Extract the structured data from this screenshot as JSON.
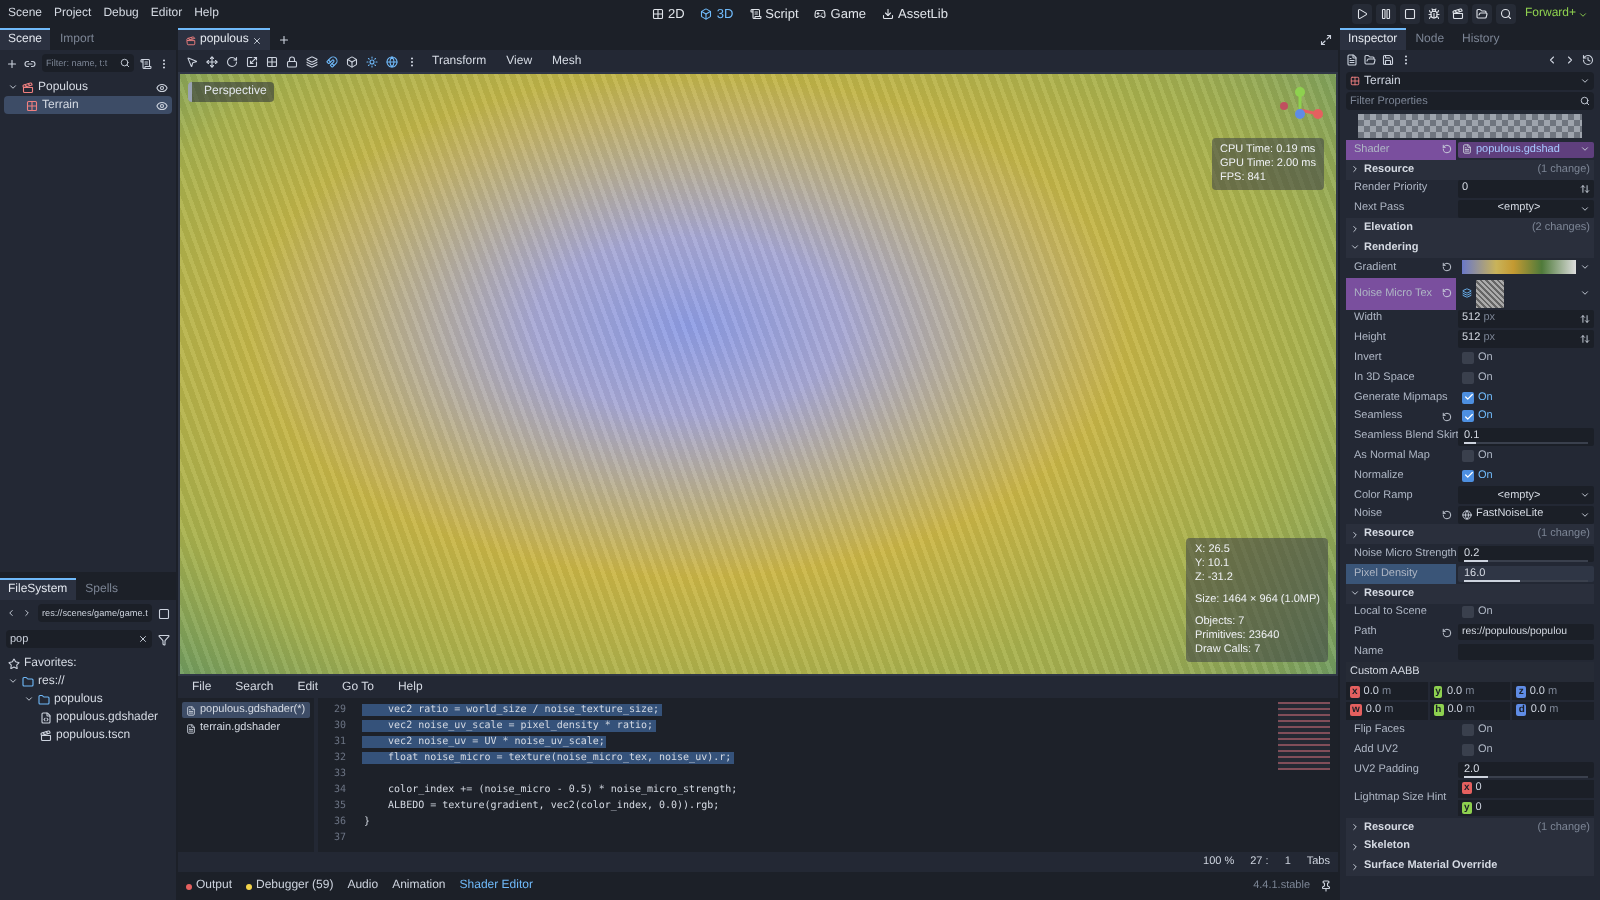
{
  "menu": [
    "Scene",
    "Project",
    "Debug",
    "Editor",
    "Help"
  ],
  "workspaces": [
    {
      "label": "2D",
      "selected": false
    },
    {
      "label": "3D",
      "selected": true
    },
    {
      "label": "Script",
      "selected": false
    },
    {
      "label": "Game",
      "selected": false
    },
    {
      "label": "AssetLib",
      "selected": false
    }
  ],
  "run_bar": {
    "renderer": "Forward+"
  },
  "scene_dock": {
    "tabs": [
      {
        "label": "Scene",
        "selected": true
      },
      {
        "label": "Import",
        "selected": false
      }
    ],
    "filter": {
      "placeholder": "Filter: name, t:t"
    },
    "tree": [
      {
        "name": "Populous",
        "selected": false,
        "children": [
          {
            "name": "Terrain",
            "selected": true
          }
        ]
      }
    ]
  },
  "filesystem": {
    "tabs": [
      {
        "label": "FileSystem",
        "selected": true
      },
      {
        "label": "Spells",
        "selected": false
      }
    ],
    "path": "res://scenes/game/game.t",
    "search": {
      "value": "pop"
    },
    "tree": [
      {
        "name": "Favorites:",
        "kind": "favorites"
      },
      {
        "name": "res://",
        "kind": "folder",
        "children": [
          {
            "name": "populous",
            "kind": "folder",
            "children": [
              {
                "name": "populous.gdshader",
                "kind": "shader"
              },
              {
                "name": "populous.tscn",
                "kind": "scene"
              }
            ]
          }
        ]
      }
    ]
  },
  "viewport": {
    "tabs": [
      {
        "label": "populous",
        "selected": true
      }
    ],
    "menus": [
      "Transform",
      "View",
      "Mesh"
    ],
    "view_label": "Perspective",
    "stats": [
      "CPU Time: 0.19 ms",
      "GPU Time: 2.00 ms",
      "FPS: 841"
    ],
    "info": [
      [
        "X: 26.5",
        "Y: 10.1",
        "Z: -31.2"
      ],
      [
        "Size: 1464 × 964 (1.0MP)"
      ],
      [
        "Objects: 7",
        "Primitives: 23640",
        "Draw Calls: 7"
      ]
    ]
  },
  "script_editor": {
    "menus": [
      "File",
      "Search",
      "Edit",
      "Go To",
      "Help"
    ],
    "files": [
      {
        "name": "populous.gdshader(*)",
        "selected": true
      },
      {
        "name": "terrain.gdshader",
        "selected": false
      }
    ],
    "lines": [
      {
        "number": "29",
        "code": "    vec2 ratio = world_size / noise_texture_size;",
        "selected": true
      },
      {
        "number": "30",
        "code": "    vec2 noise_uv_scale = pixel_density * ratio;",
        "selected": true
      },
      {
        "number": "31",
        "code": "    vec2 noise_uv = UV * noise_uv_scale;",
        "selected": true
      },
      {
        "number": "32",
        "code": "    float noise_micro = texture(noise_micro_tex, noise_uv).r;",
        "selected": true
      },
      {
        "number": "33",
        "selected": false
      },
      {
        "number": "34",
        "code": "    color_index += (noise_micro - 0.5) * noise_micro_strength;",
        "selected": false
      },
      {
        "number": "35",
        "code": "    ALBEDO = texture(gradient, vec2(color_index, 0.0)).rgb;",
        "selected": false
      },
      {
        "number": "36",
        "code": "}",
        "selected": false
      },
      {
        "number": "37",
        "selected": false
      }
    ],
    "status": {
      "zoom": "100 %",
      "line": "27 :",
      "column": "1",
      "indent": "Tabs"
    }
  },
  "bottom_panel": {
    "tabs": [
      {
        "label": "Output",
        "selected": false,
        "color": "#e5605f"
      },
      {
        "label": "Debugger (59)",
        "selected": false,
        "color": "#f3d34a"
      },
      {
        "label": "Audio",
        "selected": false
      },
      {
        "label": "Animation",
        "selected": false
      },
      {
        "label": "Shader Editor",
        "selected": true
      }
    ],
    "version": "4.4.1.stable"
  },
  "inspector": {
    "tabs": [
      {
        "label": "Inspector",
        "selected": true
      },
      {
        "label": "Node",
        "selected": false
      },
      {
        "label": "History",
        "selected": false
      }
    ],
    "object": "Terrain",
    "filter": {
      "placeholder": "Filter Properties"
    },
    "properties": [
      {
        "kind": "preview"
      },
      {
        "kind": "resource",
        "label": "Shader",
        "value": "populous.gdshad",
        "expanded": true,
        "modified": true
      },
      {
        "kind": "section",
        "label": "Resource",
        "note": "(1 change)",
        "expanded": false
      },
      {
        "kind": "spin",
        "label": "Render Priority",
        "value": "0",
        "modified": false
      },
      {
        "kind": "dropdown",
        "label": "Next Pass",
        "value": "<empty>",
        "modified": false
      },
      {
        "kind": "section",
        "label": "Elevation",
        "note": "(2 changes)",
        "expanded": false
      },
      {
        "kind": "section",
        "label": "Rendering",
        "expanded": true
      },
      {
        "kind": "gradient",
        "label": "Gradient",
        "modified": true
      },
      {
        "kind": "texture",
        "label": "Noise Micro Tex",
        "expanded": true,
        "modified": true
      },
      {
        "kind": "spin",
        "label": "Width",
        "value": "512",
        "unit": "px",
        "modified": false
      },
      {
        "kind": "spin",
        "label": "Height",
        "value": "512",
        "unit": "px",
        "modified": false
      },
      {
        "kind": "check",
        "label": "Invert",
        "text": "On",
        "checked": false,
        "modified": false
      },
      {
        "kind": "check",
        "label": "In 3D Space",
        "text": "On",
        "checked": false,
        "modified": false
      },
      {
        "kind": "check",
        "label": "Generate Mipmaps",
        "text": "On",
        "checked": true,
        "modified": false
      },
      {
        "kind": "check",
        "label": "Seamless",
        "text": "On",
        "checked": true,
        "modified": true
      },
      {
        "kind": "slider",
        "label": "Seamless Blend Skirt",
        "value": "0.1",
        "level": 0.1,
        "focused": false,
        "modified": false
      },
      {
        "kind": "check",
        "label": "As Normal Map",
        "text": "On",
        "checked": false,
        "modified": false
      },
      {
        "kind": "check",
        "label": "Normalize",
        "text": "On",
        "checked": true,
        "modified": false
      },
      {
        "kind": "dropdown",
        "label": "Color Ramp",
        "value": "<empty>",
        "modified": false
      },
      {
        "kind": "resource",
        "label": "Noise",
        "value": "FastNoiseLite",
        "expanded": false,
        "modified": true
      },
      {
        "kind": "section",
        "label": "Resource",
        "note": "(1 change)",
        "expanded": false
      },
      {
        "kind": "slider",
        "label": "Noise Micro Strength",
        "value": "0.2",
        "level": 0.2,
        "focused": false,
        "modified": false
      },
      {
        "kind": "slider",
        "label": "Pixel Density",
        "value": "16.0",
        "level": 0.45,
        "focused": true,
        "modified": false
      },
      {
        "kind": "section",
        "label": "Resource",
        "expanded": true
      },
      {
        "kind": "check",
        "label": "Local to Scene",
        "text": "On",
        "checked": false,
        "modified": false
      },
      {
        "kind": "text",
        "label": "Path",
        "value": "res://populous/populou",
        "modified": true
      },
      {
        "kind": "text",
        "label": "Name",
        "modified": false
      },
      {
        "kind": "heading",
        "label": "Custom AABB"
      },
      {
        "kind": "vector",
        "fields": [
          {
            "axis": "x",
            "value": "0.0",
            "unit": "m",
            "color": "#e5605f"
          },
          {
            "axis": "y",
            "value": "0.0",
            "unit": "m",
            "color": "#8ed14f"
          },
          {
            "axis": "z",
            "value": "0.0",
            "unit": "m",
            "color": "#5f8ce5"
          }
        ]
      },
      {
        "kind": "vector",
        "fields": [
          {
            "axis": "w",
            "value": "0.0",
            "unit": "m",
            "color": "#e5605f"
          },
          {
            "axis": "h",
            "value": "0.0",
            "unit": "m",
            "color": "#8ed14f"
          },
          {
            "axis": "d",
            "value": "0.0",
            "unit": "m",
            "color": "#5f8ce5"
          }
        ]
      },
      {
        "kind": "check",
        "label": "Flip Faces",
        "text": "On",
        "checked": false,
        "modified": false
      },
      {
        "kind": "check",
        "label": "Add UV2",
        "text": "On",
        "checked": false,
        "modified": false
      },
      {
        "kind": "slider",
        "label": "UV2 Padding",
        "value": "2.0",
        "level": 0.2,
        "focused": false,
        "modified": false
      },
      {
        "kind": "vector2",
        "label": "Lightmap Size Hint",
        "modified": false,
        "fields": [
          {
            "axis": "x",
            "value": "0",
            "color": "#e5605f"
          },
          {
            "axis": "y",
            "value": "0",
            "color": "#8ed14f"
          }
        ]
      },
      {
        "kind": "section",
        "label": "Resource",
        "note": "(1 change)",
        "expanded": false
      },
      {
        "kind": "section",
        "label": "Skeleton",
        "expanded": false
      },
      {
        "kind": "section",
        "label": "Surface Material Override",
        "expanded": false
      }
    ]
  }
}
